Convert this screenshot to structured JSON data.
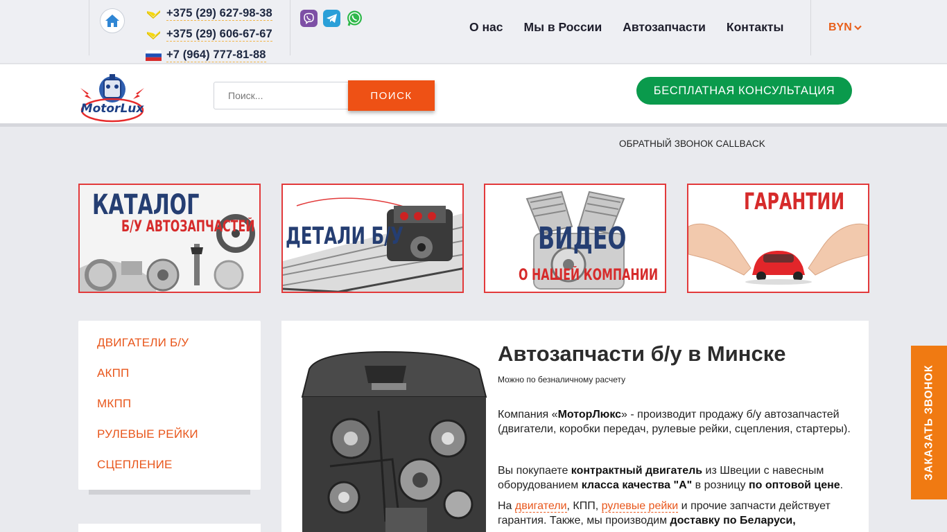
{
  "topbar": {
    "phones": [
      {
        "operator": "velcom",
        "number": "+375 (29) 627-98-38"
      },
      {
        "operator": "velcom",
        "number": "+375 (29) 606-67-67"
      },
      {
        "operator": "russia",
        "number": "+7 (964) 777-81-88"
      }
    ],
    "messengers": [
      "viber-icon",
      "telegram-icon",
      "whatsapp-icon"
    ],
    "nav": [
      {
        "label": "О нас"
      },
      {
        "label": "Мы в России"
      },
      {
        "label": "Автозапчасти"
      },
      {
        "label": "Контакты"
      }
    ],
    "currency": "BYN"
  },
  "header": {
    "logo_text": "MotorLux",
    "search_placeholder": "Поиск...",
    "search_button": "ПОИСК",
    "consult_button": "БЕСПЛАТНАЯ КОНСУЛЬТАЦИЯ",
    "callback_link": "ОБРАТНЫЙ ЗВОНОК CALLBACK"
  },
  "banners": [
    {
      "title": "КАТАЛОГ",
      "subtitle": "Б/У АВТОЗАПЧАСТЕЙ"
    },
    {
      "title": "ДЕТАЛИ Б/У"
    },
    {
      "title": "ВИДЕО",
      "subtitle": "О НАШЕЙ КОМПАНИИ"
    },
    {
      "title": "ГАРАНТИИ"
    }
  ],
  "sidebar": {
    "items": [
      {
        "label": "ДВИГАТЕЛИ Б/У"
      },
      {
        "label": "АКПП"
      },
      {
        "label": "МКПП"
      },
      {
        "label": "РУЛЕВЫЕ РЕЙКИ"
      },
      {
        "label": "СЦЕПЛЕНИЕ"
      }
    ]
  },
  "main": {
    "title": "Автозапчасти б/у в Минске",
    "subtitle": "Можно по безналичному расчету",
    "p1": {
      "t1": "Компания «",
      "b1": "МоторЛюкс",
      "t2": "» - производит продажу б/у автозапчастей (двигатели, коробки передач, рулевые рейки, сцепления, стартеры)."
    },
    "p2": {
      "t1": "Вы покупаете ",
      "b1": "контрактный двигатель",
      "t2": " из Швеции с навесным оборудованием ",
      "b2": "класса качества \"А\"",
      "t3": " в розницу ",
      "b3": "по оптовой цене",
      "t4": "."
    },
    "p3": {
      "t1": "На ",
      "l1": "двигатели",
      "t2": ", КПП, ",
      "l2": "рулевые рейки",
      "t3": " и прочие запчасти действует гарантия. Также, мы производим ",
      "b1": "доставку по Беларуси,"
    }
  },
  "order_call": "ЗАКАЗАТЬ ЗВОНОК",
  "colors": {
    "accent_orange": "#ee5115",
    "consult_green": "#0a9a4c",
    "banner_border": "#e2393a",
    "side_tab": "#f07a12"
  }
}
